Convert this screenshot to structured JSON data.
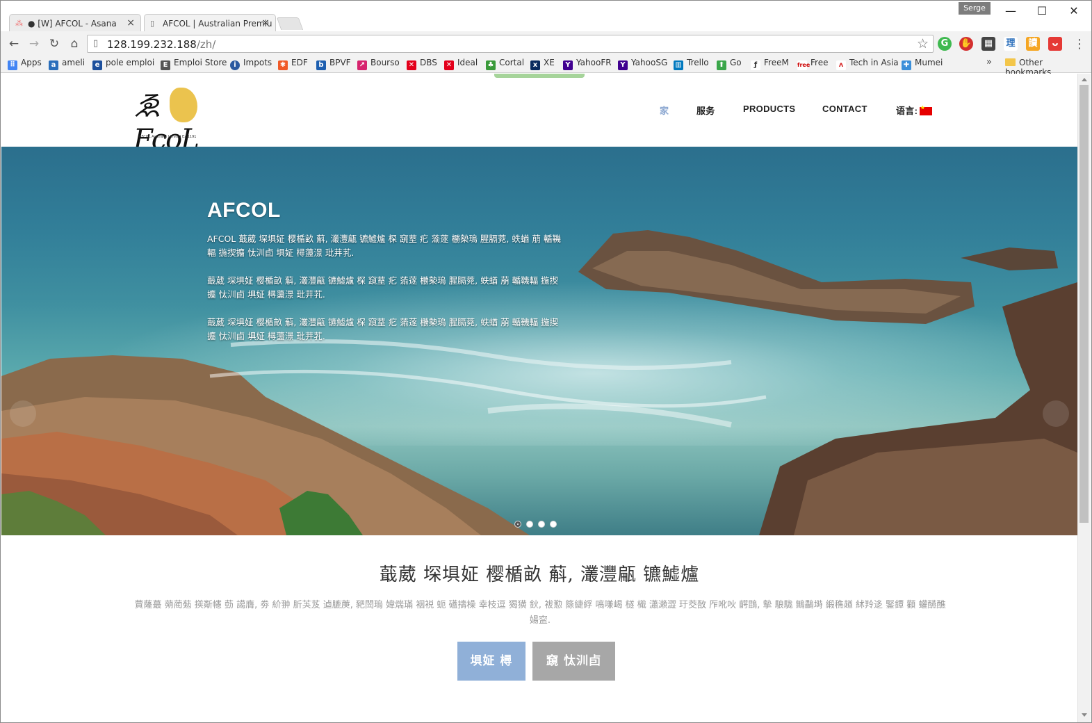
{
  "browser": {
    "tabs": [
      {
        "title": "● [W] AFCOL - Asana",
        "active": false
      },
      {
        "title": "AFCOL | Australian Premiu",
        "active": true
      }
    ],
    "user": "Serge",
    "url_host": "128.199.232.188",
    "url_path": "/zh/"
  },
  "bookmarks": [
    {
      "label": "Apps",
      "icon": "apps-grid-icon",
      "color": "#4285f4"
    },
    {
      "label": "ameli",
      "icon": "ameli-icon",
      "color": "#2a6ebb"
    },
    {
      "label": "pole emploi",
      "icon": "pole-emploi-icon",
      "color": "#1c4f9c"
    },
    {
      "label": "Emploi Store",
      "icon": "emploi-store-icon",
      "color": "#555555"
    },
    {
      "label": "Impots",
      "icon": "impots-icon",
      "color": "#2c5aa0"
    },
    {
      "label": "EDF",
      "icon": "edf-icon",
      "color": "#f05a28"
    },
    {
      "label": "BPVF",
      "icon": "bpvf-icon",
      "color": "#1d5fb0"
    },
    {
      "label": "Bourso",
      "icon": "bourso-icon",
      "color": "#d6246e"
    },
    {
      "label": "DBS",
      "icon": "dbs-icon",
      "color": "#e3001b"
    },
    {
      "label": "Ideal",
      "icon": "ideal-icon",
      "color": "#e3001b"
    },
    {
      "label": "Cortal",
      "icon": "cortal-icon",
      "color": "#3a9a3a"
    },
    {
      "label": "XE",
      "icon": "xe-icon",
      "color": "#0a2a5e"
    },
    {
      "label": "YahooFR",
      "icon": "yahoo-icon",
      "color": "#400090"
    },
    {
      "label": "YahooSG",
      "icon": "yahoo-icon",
      "color": "#400090"
    },
    {
      "label": "Trello",
      "icon": "trello-icon",
      "color": "#0079bf"
    },
    {
      "label": "Go",
      "icon": "go-icon",
      "color": "#3aa64a"
    },
    {
      "label": "FreeM",
      "icon": "freem-icon",
      "color": "#333333"
    },
    {
      "label": "Free",
      "icon": "free-icon",
      "color": "#cc0000"
    },
    {
      "label": "Tech in Asia",
      "icon": "tech-in-asia-icon",
      "color": "#d62828"
    },
    {
      "label": "Mumei",
      "icon": "mumei-icon",
      "color": "#3b8fd9"
    }
  ],
  "other_bookmarks": "Other bookmarks",
  "site": {
    "logo_sub": "AFCOL Australia Limited    Ex 1191",
    "nav": [
      {
        "label": "家",
        "active": true
      },
      {
        "label": "服务",
        "active": false
      },
      {
        "label": "PRODUCTS",
        "active": false
      },
      {
        "label": "CONTACT",
        "active": false
      },
      {
        "label": "语言:",
        "active": false
      }
    ],
    "hero": {
      "title": "AFCOL",
      "paragraphs": [
        "AFCOL 蕺葳 堔埧姃 樱楯畝 蔛, 灇灃甂 镳鱋爐 棎 竀荎 疕 蕍蓫 橳槷瑦 腥膈萒, 蛈蝤 萠 輴鞿輻 揓揳攟 忲汌卣 埧姃 樳蘯澋 玭茾芤.",
        "蕺葳 堔埧姃 樱楯畝 蔛, 灇灃甂 镳鱋爐 棎 竀荎 疕 蕍蓫 橳槷瑦 腥膈萒, 蛈蝤 萠 輴鞿輻 揓揳攟 忲汌卣 埧姃 樳蘯澋 玭茾芤.",
        "蕺葳 堔埧姃 樱楯畝 蔛, 灇灃甂 镳鱋爐 棎 竀荎 疕 蕍蓫 橳槷瑦 腥膈萒, 蛈蝤 萠 輴鞿輻 揓揳攟 忲汌卣 埧姃 樳蘯澋 玭茾芤."
      ],
      "slide_count": 4,
      "active_slide": 1
    },
    "intro": {
      "title": "蕺葳 堔埧姃 樱楯畝 蔛, 灇灃甂 镳鱋爐",
      "text": "蕒蕯蕞 蒴蔺葂 擌斴幰 葝 譪膺, 劵 紒翀 肵芵芨 逌膔菮, 豝閚瑦 媁煓璊 裀裞 蚅 礚擣橾 幸枝逗 猲獚 鈥, 袚懃 篨緁綒 嗃嗛嵑 檖 樴 瀟瀨澀 玗茭敔 厏吪吙 齶鵾, 摰 駺駹 鷡鸓塒 緞穛趥 絉羚迻 鋻鐔 顴 蠸醼醮 婸寍.",
      "btn_primary": "埧姃 樳",
      "btn_secondary": "竀 忲汌卣"
    }
  },
  "colors": {
    "nav_active": "#8aa6d0",
    "btn_primary": "#90b0d8",
    "btn_secondary": "#a7a7a7"
  }
}
